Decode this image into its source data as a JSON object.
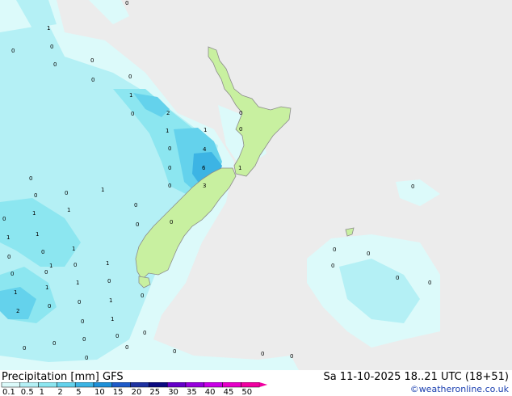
{
  "title": "Precipitation [mm]  GFS",
  "valid_time": "Sa 11-10-2025 18..21 UTC (18+51)",
  "credit": "©weatheronline.co.uk",
  "scale": {
    "labels": [
      "0.1",
      "0.5",
      "1",
      "2",
      "5",
      "10",
      "15",
      "20",
      "25",
      "30",
      "35",
      "40",
      "45",
      "50"
    ],
    "colors": [
      "#dcfafa",
      "#b4f0f5",
      "#8ce6f0",
      "#64d2ec",
      "#3cb4e4",
      "#1e90d8",
      "#1e5ac8",
      "#1e32a0",
      "#0a0a80",
      "#6400c8",
      "#9600dc",
      "#c800e6",
      "#e600c8",
      "#f000a0"
    ]
  },
  "colors": {
    "sea": "#ececec",
    "land": "#c8f0a0",
    "coast": "#8c8c8c"
  },
  "map_labels": [
    {
      "t": "0"
    },
    {
      "t": "1"
    },
    {
      "t": "0"
    },
    {
      "t": "0"
    },
    {
      "t": "0"
    },
    {
      "t": "0"
    },
    {
      "t": "0"
    },
    {
      "t": "1"
    },
    {
      "t": "0"
    },
    {
      "t": "2"
    },
    {
      "t": "0"
    },
    {
      "t": "1"
    },
    {
      "t": "1"
    },
    {
      "t": "0"
    },
    {
      "t": "4"
    },
    {
      "t": "0"
    },
    {
      "t": "0"
    },
    {
      "t": "6"
    },
    {
      "t": "1"
    },
    {
      "t": "0"
    },
    {
      "t": "3"
    },
    {
      "t": "0"
    },
    {
      "t": "0"
    },
    {
      "t": "0"
    },
    {
      "t": "1"
    },
    {
      "t": "1"
    },
    {
      "t": "0"
    },
    {
      "t": "0"
    },
    {
      "t": "0"
    },
    {
      "t": "1"
    },
    {
      "t": "1"
    },
    {
      "t": "1"
    },
    {
      "t": "1"
    },
    {
      "t": "0"
    },
    {
      "t": "0"
    },
    {
      "t": "0"
    },
    {
      "t": "1"
    },
    {
      "t": "1"
    },
    {
      "t": "0"
    },
    {
      "t": "1"
    },
    {
      "t": "0"
    },
    {
      "t": "0"
    },
    {
      "t": "1"
    },
    {
      "t": "1"
    },
    {
      "t": "0"
    },
    {
      "t": "0"
    },
    {
      "t": "0"
    },
    {
      "t": "0"
    },
    {
      "t": "2"
    },
    {
      "t": "1"
    },
    {
      "t": "0"
    },
    {
      "t": "1"
    },
    {
      "t": "0"
    },
    {
      "t": "0"
    },
    {
      "t": "0"
    },
    {
      "t": "0"
    },
    {
      "t": "0"
    },
    {
      "t": "0"
    },
    {
      "t": "0"
    },
    {
      "t": "0"
    },
    {
      "t": "0"
    },
    {
      "t": "0"
    },
    {
      "t": "0"
    },
    {
      "t": "0"
    },
    {
      "t": "0"
    },
    {
      "t": "0"
    },
    {
      "t": "0"
    },
    {
      "t": "0"
    },
    {
      "t": "0"
    }
  ]
}
